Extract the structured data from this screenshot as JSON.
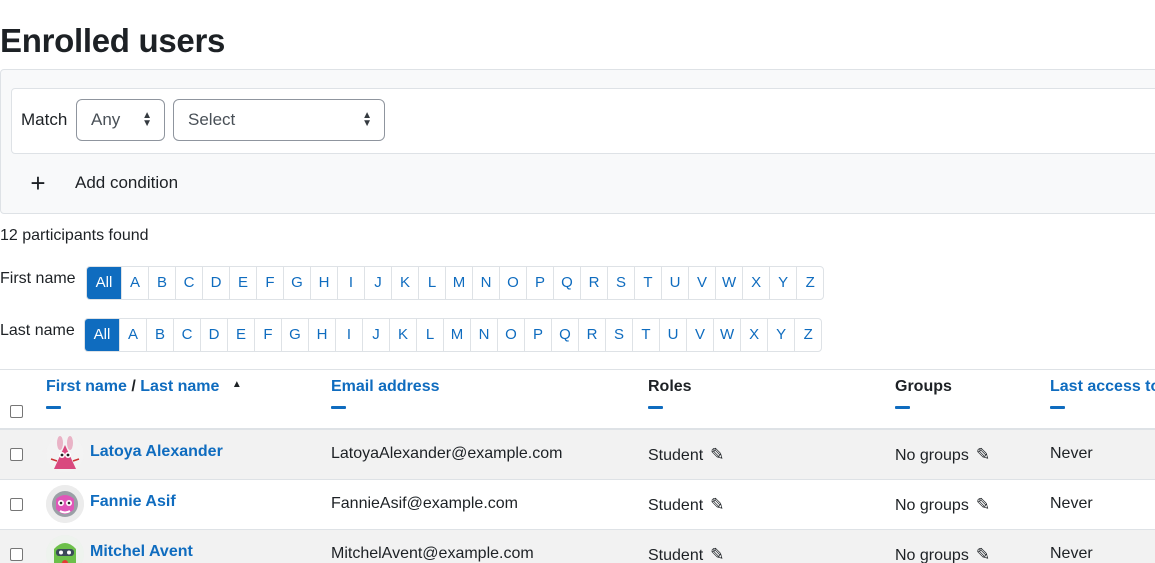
{
  "page": {
    "title": "Enrolled users"
  },
  "filter": {
    "match_label": "Match",
    "match_value": "Any",
    "condition_value": "Select",
    "add_condition_label": "Add condition"
  },
  "results": {
    "count_text": "12 participants found"
  },
  "initials": {
    "first_label": "First name",
    "last_label": "Last name",
    "letters": [
      "All",
      "A",
      "B",
      "C",
      "D",
      "E",
      "F",
      "G",
      "H",
      "I",
      "J",
      "K",
      "L",
      "M",
      "N",
      "O",
      "P",
      "Q",
      "R",
      "S",
      "T",
      "U",
      "V",
      "W",
      "X",
      "Y",
      "Z"
    ]
  },
  "table": {
    "headers": {
      "first_name": "First name",
      "separator": "/",
      "last_name": "Last name",
      "email": "Email address",
      "roles": "Roles",
      "groups": "Groups",
      "last_access": "Last access to"
    },
    "rows": [
      {
        "name": "Latoya Alexander",
        "email": "LatoyaAlexander@example.com",
        "role": "Student",
        "groups": "No groups",
        "last_access": "Never"
      },
      {
        "name": "Fannie Asif",
        "email": "FannieAsif@example.com",
        "role": "Student",
        "groups": "No groups",
        "last_access": "Never"
      },
      {
        "name": "Mitchel Avent",
        "email": "MitchelAvent@example.com",
        "role": "Student",
        "groups": "No groups",
        "last_access": "Never"
      }
    ]
  },
  "colors": {
    "link": "#0f6cbf",
    "text": "#1d2125",
    "border": "#dee2e6",
    "row_stripe": "#f2f2f2"
  },
  "icons": {
    "pencil": "pencil-icon",
    "plus": "plus-icon",
    "sort": "sort-ascending-icon"
  }
}
